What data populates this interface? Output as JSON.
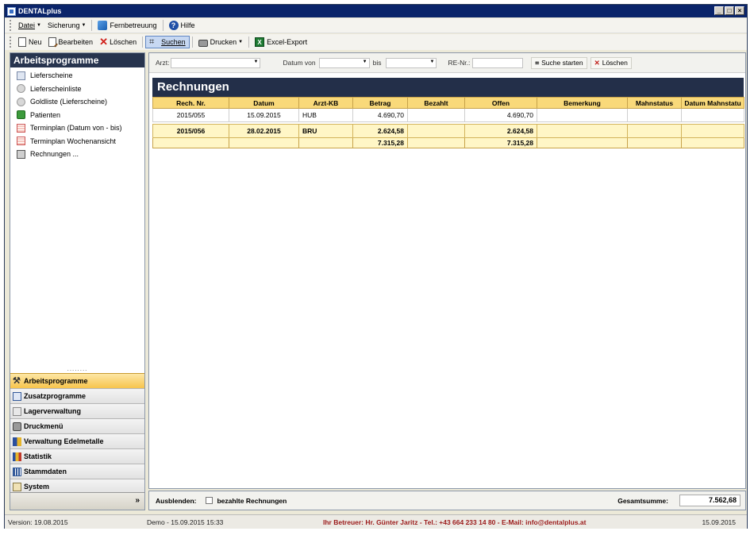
{
  "window": {
    "title": "DENTALplus"
  },
  "menu": {
    "datei": "Datei",
    "sicherung": "Sicherung",
    "fernbetreuung": "Fernbetreuung",
    "hilfe": "Hilfe"
  },
  "toolbar": {
    "neu": "Neu",
    "bearbeiten": "Bearbeiten",
    "loeschen": "Löschen",
    "suchen": "Suchen",
    "drucken": "Drucken",
    "excel": "Excel-Export"
  },
  "sidebar": {
    "header": "Arbeitsprogramme",
    "items": [
      {
        "label": "Lieferscheine"
      },
      {
        "label": "Lieferscheinliste"
      },
      {
        "label": "Goldliste (Lieferscheine)"
      },
      {
        "label": "Patienten"
      },
      {
        "label": "Terminplan (Datum von - bis)"
      },
      {
        "label": "Terminplan Wochenansicht"
      },
      {
        "label": "Rechnungen ..."
      }
    ],
    "grip": "........",
    "nav": [
      {
        "label": "Arbeitsprogramme"
      },
      {
        "label": "Zusatzprogramme"
      },
      {
        "label": "Lagerverwaltung"
      },
      {
        "label": "Druckmenü"
      },
      {
        "label": "Verwaltung Edelmetalle"
      },
      {
        "label": "Statistik"
      },
      {
        "label": "Stammdaten"
      },
      {
        "label": "System"
      }
    ],
    "more": "»"
  },
  "filter": {
    "arzt_label": "Arzt:",
    "datum_von_label": "Datum von",
    "bis_label": "bis",
    "re_nr_label": "RE-Nr.:",
    "suche_starten": "Suche starten",
    "loeschen": "Löschen"
  },
  "main": {
    "title": "Rechnungen",
    "columns": [
      "Rech. Nr.",
      "Datum",
      "Arzt-KB",
      "Betrag",
      "Bezahlt",
      "Offen",
      "Bemerkung",
      "Mahnstatus",
      "Datum Mahnstatu"
    ],
    "rows": [
      {
        "nr": "2015/055",
        "datum": "15.09.2015",
        "arzt": "HUB",
        "betrag": "4.690,70",
        "bezahlt": "",
        "offen": "4.690,70",
        "bemerkung": "",
        "mahnstatus": "",
        "datum_mahn": ""
      },
      {
        "nr": "2015/056",
        "datum": "28.02.2015",
        "arzt": "BRU",
        "betrag": "2.624,58",
        "bezahlt": "",
        "offen": "2.624,58",
        "bemerkung": "",
        "mahnstatus": "",
        "datum_mahn": ""
      }
    ],
    "sum": {
      "betrag": "7.315,28",
      "offen": "7.315,28"
    }
  },
  "bottom": {
    "ausblenden": "Ausblenden:",
    "bezahlte": "bezahlte Rechnungen",
    "gesamtsumme_label": "Gesamtsumme:",
    "gesamtsumme": "7.562,68"
  },
  "status": {
    "version": "Version: 19.08.2015",
    "demo": "Demo - 15.09.2015 15:33",
    "credit": "Ihr Betreuer: Hr. Günter Jaritz - Tel.: +43 664 233 14 80 - E-Mail: info@dentalplus.at",
    "date": "15.09.2015"
  }
}
